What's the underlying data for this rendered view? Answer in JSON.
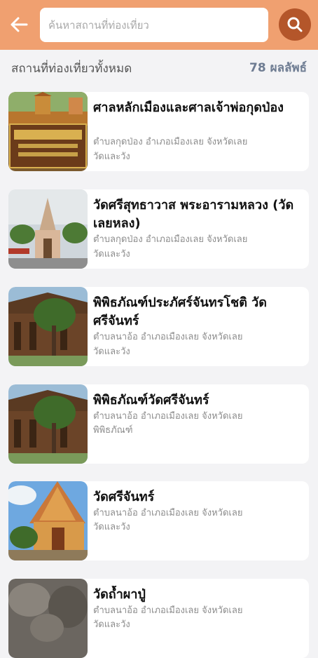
{
  "header": {
    "search_placeholder": "ค้นหาสถานที่ท่องเที่ยว",
    "accent_color": "#f0a070",
    "search_button_color": "#b4562a"
  },
  "section": {
    "title": "สถานที่ท่องเที่ยวทั้งหมด",
    "count": "78 ผลลัพธ์"
  },
  "places": [
    {
      "title": "ศาลหลักเมืองและศาลเจ้าพ่อกุดป่อง",
      "location": "ตำบลกุดป่อง อำเภอเมืองเลย จังหวัดเลย",
      "category": "วัดและวัง"
    },
    {
      "title": "วัดศรีสุทธาวาส พระอารามหลวง (วัดเลยหลง)",
      "location": "ตำบลกุดป่อง อำเภอเมืองเลย จังหวัดเลย",
      "category": "วัดและวัง"
    },
    {
      "title": "พิพิธภัณฑ์ประภัศร์จันทรโชติ วัดศรีจันทร์",
      "location": "ตำบลนาอ้อ อำเภอเมืองเลย จังหวัดเลย",
      "category": "วัดและวัง"
    },
    {
      "title": "พิพิธภัณฑ์วัดศรีจันทร์",
      "location": "ตำบลนาอ้อ อำเภอเมืองเลย จังหวัดเลย",
      "category": "พิพิธภัณฑ์"
    },
    {
      "title": "วัดศรีจันทร์",
      "location": "ตำบลนาอ้อ อำเภอเมืองเลย จังหวัดเลย",
      "category": "วัดและวัง"
    },
    {
      "title": "วัดถ้ำผาปู่",
      "location": "ตำบลนาอ้อ อำเภอเมืองเลย จังหวัดเลย",
      "category": "วัดและวัง"
    }
  ]
}
